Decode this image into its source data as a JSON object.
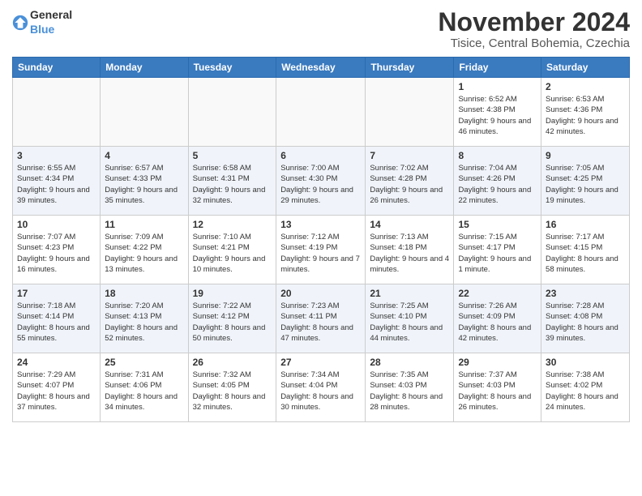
{
  "header": {
    "logo": {
      "general": "General",
      "blue": "Blue"
    },
    "month": "November 2024",
    "location": "Tisice, Central Bohemia, Czechia"
  },
  "days_of_week": [
    "Sunday",
    "Monday",
    "Tuesday",
    "Wednesday",
    "Thursday",
    "Friday",
    "Saturday"
  ],
  "weeks": [
    [
      {
        "num": "",
        "info": ""
      },
      {
        "num": "",
        "info": ""
      },
      {
        "num": "",
        "info": ""
      },
      {
        "num": "",
        "info": ""
      },
      {
        "num": "",
        "info": ""
      },
      {
        "num": "1",
        "info": "Sunrise: 6:52 AM\nSunset: 4:38 PM\nDaylight: 9 hours and 46 minutes."
      },
      {
        "num": "2",
        "info": "Sunrise: 6:53 AM\nSunset: 4:36 PM\nDaylight: 9 hours and 42 minutes."
      }
    ],
    [
      {
        "num": "3",
        "info": "Sunrise: 6:55 AM\nSunset: 4:34 PM\nDaylight: 9 hours and 39 minutes."
      },
      {
        "num": "4",
        "info": "Sunrise: 6:57 AM\nSunset: 4:33 PM\nDaylight: 9 hours and 35 minutes."
      },
      {
        "num": "5",
        "info": "Sunrise: 6:58 AM\nSunset: 4:31 PM\nDaylight: 9 hours and 32 minutes."
      },
      {
        "num": "6",
        "info": "Sunrise: 7:00 AM\nSunset: 4:30 PM\nDaylight: 9 hours and 29 minutes."
      },
      {
        "num": "7",
        "info": "Sunrise: 7:02 AM\nSunset: 4:28 PM\nDaylight: 9 hours and 26 minutes."
      },
      {
        "num": "8",
        "info": "Sunrise: 7:04 AM\nSunset: 4:26 PM\nDaylight: 9 hours and 22 minutes."
      },
      {
        "num": "9",
        "info": "Sunrise: 7:05 AM\nSunset: 4:25 PM\nDaylight: 9 hours and 19 minutes."
      }
    ],
    [
      {
        "num": "10",
        "info": "Sunrise: 7:07 AM\nSunset: 4:23 PM\nDaylight: 9 hours and 16 minutes."
      },
      {
        "num": "11",
        "info": "Sunrise: 7:09 AM\nSunset: 4:22 PM\nDaylight: 9 hours and 13 minutes."
      },
      {
        "num": "12",
        "info": "Sunrise: 7:10 AM\nSunset: 4:21 PM\nDaylight: 9 hours and 10 minutes."
      },
      {
        "num": "13",
        "info": "Sunrise: 7:12 AM\nSunset: 4:19 PM\nDaylight: 9 hours and 7 minutes."
      },
      {
        "num": "14",
        "info": "Sunrise: 7:13 AM\nSunset: 4:18 PM\nDaylight: 9 hours and 4 minutes."
      },
      {
        "num": "15",
        "info": "Sunrise: 7:15 AM\nSunset: 4:17 PM\nDaylight: 9 hours and 1 minute."
      },
      {
        "num": "16",
        "info": "Sunrise: 7:17 AM\nSunset: 4:15 PM\nDaylight: 8 hours and 58 minutes."
      }
    ],
    [
      {
        "num": "17",
        "info": "Sunrise: 7:18 AM\nSunset: 4:14 PM\nDaylight: 8 hours and 55 minutes."
      },
      {
        "num": "18",
        "info": "Sunrise: 7:20 AM\nSunset: 4:13 PM\nDaylight: 8 hours and 52 minutes."
      },
      {
        "num": "19",
        "info": "Sunrise: 7:22 AM\nSunset: 4:12 PM\nDaylight: 8 hours and 50 minutes."
      },
      {
        "num": "20",
        "info": "Sunrise: 7:23 AM\nSunset: 4:11 PM\nDaylight: 8 hours and 47 minutes."
      },
      {
        "num": "21",
        "info": "Sunrise: 7:25 AM\nSunset: 4:10 PM\nDaylight: 8 hours and 44 minutes."
      },
      {
        "num": "22",
        "info": "Sunrise: 7:26 AM\nSunset: 4:09 PM\nDaylight: 8 hours and 42 minutes."
      },
      {
        "num": "23",
        "info": "Sunrise: 7:28 AM\nSunset: 4:08 PM\nDaylight: 8 hours and 39 minutes."
      }
    ],
    [
      {
        "num": "24",
        "info": "Sunrise: 7:29 AM\nSunset: 4:07 PM\nDaylight: 8 hours and 37 minutes."
      },
      {
        "num": "25",
        "info": "Sunrise: 7:31 AM\nSunset: 4:06 PM\nDaylight: 8 hours and 34 minutes."
      },
      {
        "num": "26",
        "info": "Sunrise: 7:32 AM\nSunset: 4:05 PM\nDaylight: 8 hours and 32 minutes."
      },
      {
        "num": "27",
        "info": "Sunrise: 7:34 AM\nSunset: 4:04 PM\nDaylight: 8 hours and 30 minutes."
      },
      {
        "num": "28",
        "info": "Sunrise: 7:35 AM\nSunset: 4:03 PM\nDaylight: 8 hours and 28 minutes."
      },
      {
        "num": "29",
        "info": "Sunrise: 7:37 AM\nSunset: 4:03 PM\nDaylight: 8 hours and 26 minutes."
      },
      {
        "num": "30",
        "info": "Sunrise: 7:38 AM\nSunset: 4:02 PM\nDaylight: 8 hours and 24 minutes."
      }
    ]
  ]
}
